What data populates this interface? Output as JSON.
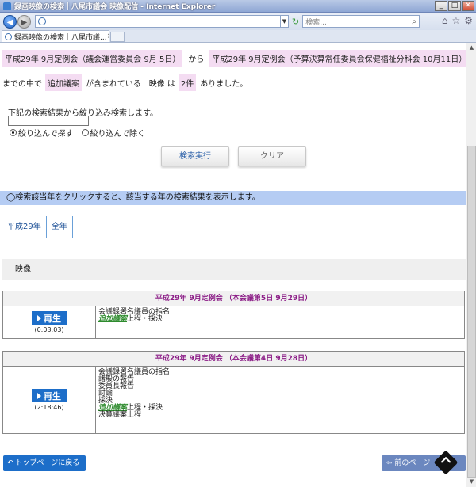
{
  "window": {
    "title": "録画映像の検索｜八尾市議会 映像配信 - Internet Explorer",
    "min": "_",
    "max": "□",
    "close": "✕"
  },
  "browser": {
    "search_placeholder": "検索...",
    "tab_label": "録画映像の検索｜八尾市議...",
    "tab_close": "×"
  },
  "range": {
    "from": "平成29年 9月定例会（議会運営委員会 9月 5日）",
    "from_word": "から",
    "to": "平成29年 9月定例会（予算決算常任委員会保健福祉分科会 10月11日）"
  },
  "result": {
    "prefix": "までの中で",
    "keyword": "追加議案",
    "middle": "が含まれている　映像 は",
    "count": "2件",
    "suffix": "ありました。"
  },
  "refine": {
    "label": "下記の検索結果から絞り込み検索します。",
    "input_value": "",
    "options": [
      "絞り込んで探す",
      "絞り込んで除く"
    ]
  },
  "buttons": {
    "search": "検索実行",
    "clear": "クリア",
    "top_page": "トップページに戻る",
    "prev_page": "前のページ"
  },
  "notice": "◯検索該当年をクリックすると、該当する年の検索結果を表示します。",
  "year_tabs": [
    "平成29年",
    "全年"
  ],
  "section_title": "映像",
  "results": [
    {
      "heading": "平成29年 9月定例会 （本会議第5日 9月29日）",
      "play_label": "再生",
      "duration": "(0:03:03)",
      "lines": [
        "会議録署名議員の指名"
      ],
      "tag_line": {
        "tag": "追加議案",
        "rest": "上程・採決"
      },
      "after_lines": []
    },
    {
      "heading": "平成29年 9月定例会 （本会議第4日 9月28日）",
      "play_label": "再生",
      "duration": "(2:18:46)",
      "lines": [
        "会議録署名議員の指名",
        "諸般の報告",
        "委員長報告",
        "討論",
        "採決"
      ],
      "tag_line": {
        "tag": "追加議案",
        "rest": "上程・採決"
      },
      "after_lines": [
        "決算議案上程"
      ]
    }
  ]
}
